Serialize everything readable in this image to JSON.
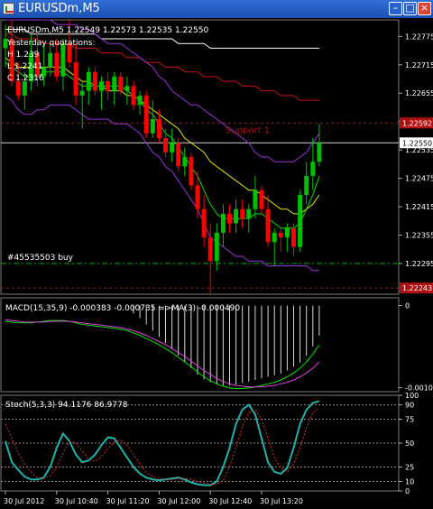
{
  "window": {
    "title": "EURUSDm,M5",
    "icon": "chart-window-icon",
    "buttons": {
      "minimize": "–",
      "maximize": "□",
      "close": "×"
    }
  },
  "colors": {
    "background": "#000000",
    "grid": "#6a6a6a",
    "axis_text": "#ffffff",
    "bull": "#00c000",
    "bear": "#ff0000",
    "bollinger": "#9b30d9",
    "ma_yellow": "#e6e600",
    "ma_green": "#00e000",
    "ma_red": "#d01010",
    "ma_white": "#ffffff",
    "support": "#b01010",
    "buy_line": "#00b000",
    "stoch_main": "#20b2aa",
    "stoch_signal": "#e03030"
  },
  "chart_data": [
    {
      "type": "candlestick",
      "title": "EURUSDm,M5  1.22549 1.22573 1.22535 1.22550",
      "notes": [
        "Yesterday quotations:",
        "H 1.239",
        "L 1.2241",
        "C 1.2316"
      ],
      "support_label": "Support 1",
      "support_price": 1.22592,
      "bid_price": 1.2255,
      "buy_level": 1.22295,
      "buy_label": "#45535503 buy",
      "bottom_level": 1.22243,
      "ylim": [
        1.2223,
        1.2281
      ],
      "y_ticks": [
        "1.22775",
        "1.22715",
        "1.22655",
        "1.22595",
        "1.22535",
        "1.22475",
        "1.22415",
        "1.22355",
        "1.22295"
      ],
      "highlight_ticks": [
        {
          "label": "1.22592",
          "value": 1.22592,
          "color": "#b01010"
        },
        {
          "label": "1.22550",
          "value": 1.2255,
          "color": "#ffffff"
        },
        {
          "label": "1.22243",
          "value": 1.22243,
          "color": "#b01010"
        }
      ],
      "candles": [
        [
          1.2275,
          1.228,
          1.2271,
          1.2277
        ],
        [
          1.2277,
          1.2281,
          1.2267,
          1.2268
        ],
        [
          1.2268,
          1.2272,
          1.2264,
          1.2265
        ],
        [
          1.2265,
          1.227,
          1.2262,
          1.2268
        ],
        [
          1.2268,
          1.2278,
          1.2266,
          1.2274
        ],
        [
          1.2274,
          1.2278,
          1.2267,
          1.2269
        ],
        [
          1.2269,
          1.2276,
          1.2267,
          1.2271
        ],
        [
          1.2271,
          1.2276,
          1.2269,
          1.2274
        ],
        [
          1.2274,
          1.2277,
          1.2268,
          1.2269
        ],
        [
          1.2269,
          1.2277,
          1.2266,
          1.2276
        ],
        [
          1.2276,
          1.2281,
          1.2271,
          1.2272
        ],
        [
          1.2272,
          1.2276,
          1.2263,
          1.2265
        ],
        [
          1.2265,
          1.2268,
          1.2258,
          1.2266
        ],
        [
          1.2266,
          1.2271,
          1.2263,
          1.227
        ],
        [
          1.227,
          1.2271,
          1.2265,
          1.2266
        ],
        [
          1.2266,
          1.2269,
          1.2262,
          1.2268
        ],
        [
          1.2268,
          1.227,
          1.2264,
          1.2266
        ],
        [
          1.2266,
          1.227,
          1.2263,
          1.2269
        ],
        [
          1.2269,
          1.227,
          1.2265,
          1.2266
        ],
        [
          1.2266,
          1.2269,
          1.2263,
          1.2267
        ],
        [
          1.2267,
          1.2268,
          1.2262,
          1.2263
        ],
        [
          1.2263,
          1.2266,
          1.2261,
          1.2265
        ],
        [
          1.2265,
          1.2266,
          1.2256,
          1.2257
        ],
        [
          1.2257,
          1.2264,
          1.2256,
          1.226
        ],
        [
          1.226,
          1.2262,
          1.2255,
          1.2256
        ],
        [
          1.2256,
          1.2258,
          1.2252,
          1.2253
        ],
        [
          1.2253,
          1.2258,
          1.2251,
          1.2255
        ],
        [
          1.2255,
          1.2256,
          1.2249,
          1.225
        ],
        [
          1.225,
          1.2254,
          1.2248,
          1.2252
        ],
        [
          1.2252,
          1.2253,
          1.2245,
          1.2246
        ],
        [
          1.2246,
          1.2249,
          1.2239,
          1.2241
        ],
        [
          1.2241,
          1.2244,
          1.2233,
          1.2235
        ],
        [
          1.2235,
          1.2238,
          1.2223,
          1.223
        ],
        [
          1.223,
          1.2238,
          1.2228,
          1.2236
        ],
        [
          1.2236,
          1.2242,
          1.2233,
          1.224
        ],
        [
          1.224,
          1.2242,
          1.2236,
          1.2238
        ],
        [
          1.2238,
          1.2243,
          1.2236,
          1.2241
        ],
        [
          1.2241,
          1.2243,
          1.2237,
          1.2239
        ],
        [
          1.2239,
          1.2242,
          1.2236,
          1.2241
        ],
        [
          1.2241,
          1.2248,
          1.2239,
          1.2245
        ],
        [
          1.2245,
          1.2246,
          1.224,
          1.2241
        ],
        [
          1.2241,
          1.2244,
          1.2233,
          1.2234
        ],
        [
          1.2234,
          1.2237,
          1.2229,
          1.2236
        ],
        [
          1.2236,
          1.2237,
          1.2232,
          1.2235
        ],
        [
          1.2235,
          1.2238,
          1.2232,
          1.2237
        ],
        [
          1.2237,
          1.2238,
          1.2231,
          1.2233
        ],
        [
          1.2233,
          1.2245,
          1.2232,
          1.2244
        ],
        [
          1.2244,
          1.2251,
          1.2242,
          1.2248
        ],
        [
          1.2248,
          1.2256,
          1.2245,
          1.2251
        ],
        [
          1.2251,
          1.2259,
          1.225,
          1.2255
        ]
      ],
      "lines": [
        {
          "name": "MA white",
          "color": "#ffffff",
          "values": [
            1.2279,
            1.2279,
            1.2279,
            1.2279,
            1.2278,
            1.2278,
            1.2278,
            1.2278,
            1.2278,
            1.2278,
            1.2278,
            1.2278,
            1.2278,
            1.2278,
            1.2278,
            1.2277,
            1.2277,
            1.2277,
            1.2277,
            1.2277,
            1.2277,
            1.2277,
            1.2277,
            1.2277,
            1.2277,
            1.2277,
            1.2277,
            1.2276,
            1.2276,
            1.2276,
            1.2276,
            1.2276,
            1.2275,
            1.2275,
            1.2275,
            1.2275,
            1.2275,
            1.2275,
            1.2275,
            1.2275,
            1.2275,
            1.2275,
            1.2275,
            1.2275,
            1.2275,
            1.2275,
            1.2275,
            1.2275,
            1.2275,
            1.2275
          ]
        },
        {
          "name": "MA red",
          "color": "#d01010",
          "values": [
            1.2278,
            1.2278,
            1.2277,
            1.2277,
            1.2277,
            1.2277,
            1.2276,
            1.2276,
            1.2276,
            1.2276,
            1.2276,
            1.2275,
            1.2275,
            1.2275,
            1.2275,
            1.2274,
            1.2274,
            1.2274,
            1.2274,
            1.2273,
            1.2273,
            1.2273,
            1.2272,
            1.2272,
            1.2272,
            1.2271,
            1.2271,
            1.2271,
            1.227,
            1.227,
            1.227,
            1.2269,
            1.2269,
            1.2269,
            1.2268,
            1.2268,
            1.2268,
            1.2267,
            1.2267,
            1.2267,
            1.2266,
            1.2266,
            1.2266,
            1.2265,
            1.2265,
            1.2265,
            1.2264,
            1.2264,
            1.2264,
            1.2264
          ]
        },
        {
          "name": "BB upper",
          "color": "#9b30d9",
          "values": [
            1.2281,
            1.2281,
            1.2281,
            1.2281,
            1.2281,
            1.2281,
            1.2281,
            1.2281,
            1.228,
            1.228,
            1.228,
            1.228,
            1.2279,
            1.2279,
            1.2278,
            1.2277,
            1.2276,
            1.2276,
            1.2276,
            1.2275,
            1.2274,
            1.2273,
            1.2272,
            1.2271,
            1.2269,
            1.2268,
            1.2266,
            1.2265,
            1.2264,
            1.2263,
            1.2263,
            1.2262,
            1.2261,
            1.226,
            1.2259,
            1.2258,
            1.2257,
            1.2256,
            1.2255,
            1.2253,
            1.2252,
            1.2252,
            1.2251,
            1.2251,
            1.2251,
            1.2251,
            1.2252,
            1.2253,
            1.2255,
            1.2257
          ]
        },
        {
          "name": "BB middle",
          "color": "#e6e600",
          "values": [
            1.2273,
            1.2272,
            1.2271,
            1.2271,
            1.2271,
            1.2271,
            1.2271,
            1.2271,
            1.2271,
            1.2271,
            1.227,
            1.2269,
            1.2268,
            1.2268,
            1.2267,
            1.2267,
            1.2266,
            1.2266,
            1.2266,
            1.2265,
            1.2265,
            1.2264,
            1.2263,
            1.2262,
            1.2261,
            1.226,
            1.2259,
            1.2258,
            1.2256,
            1.2255,
            1.2254,
            1.2253,
            1.2251,
            1.225,
            1.2249,
            1.2248,
            1.2247,
            1.2246,
            1.2245,
            1.2245,
            1.2244,
            1.2243,
            1.2242,
            1.2241,
            1.2241,
            1.224,
            1.224,
            1.2241,
            1.2242,
            1.2244
          ]
        },
        {
          "name": "BB lower",
          "color": "#9b30d9",
          "values": [
            1.2265,
            1.2264,
            1.2262,
            1.2261,
            1.2261,
            1.2262,
            1.2262,
            1.2263,
            1.2263,
            1.2263,
            1.2263,
            1.2262,
            1.2261,
            1.226,
            1.226,
            1.226,
            1.226,
            1.2259,
            1.2259,
            1.2259,
            1.2258,
            1.2257,
            1.2255,
            1.2253,
            1.2252,
            1.225,
            1.2249,
            1.2247,
            1.2245,
            1.2243,
            1.2241,
            1.2238,
            1.2235,
            1.2234,
            1.2233,
            1.2232,
            1.2231,
            1.2231,
            1.223,
            1.223,
            1.223,
            1.2229,
            1.2229,
            1.2229,
            1.2229,
            1.2229,
            1.2229,
            1.2229,
            1.2228,
            1.2228
          ]
        },
        {
          "name": "MA green",
          "color": "#00e000",
          "values": [
            1.2272,
            1.2271,
            1.227,
            1.2269,
            1.2269,
            1.2269,
            1.227,
            1.227,
            1.227,
            1.227,
            1.2269,
            1.2268,
            1.2267,
            1.2267,
            1.2267,
            1.2267,
            1.2267,
            1.2267,
            1.2267,
            1.2266,
            1.2265,
            1.2264,
            1.2262,
            1.2261,
            1.2259,
            1.2257,
            1.2256,
            1.2254,
            1.2252,
            1.225,
            1.2248,
            1.2245,
            1.2242,
            1.224,
            1.2239,
            1.2239,
            1.2239,
            1.2239,
            1.2239,
            1.224,
            1.224,
            1.2239,
            1.2238,
            1.2237,
            1.2237,
            1.2237,
            1.2238,
            1.2241,
            1.2244,
            1.2248
          ]
        }
      ],
      "x_ticks": [
        "30 Jul 2012",
        "30 Jul 10:40",
        "30 Jul 11:20",
        "30 Jul 12:00",
        "30 Jul 12:40",
        "30 Jul 13:20"
      ]
    },
    {
      "type": "bar",
      "title": "MACD(15,35,9) -0.000383 -0.000735 =>MA(3) -0.000490",
      "ylim": [
        -0.0011,
        0.0001
      ],
      "y_ticks": [
        {
          "label": "0",
          "value": 0.0
        },
        {
          "label": "-0.00105",
          "value": -0.00105
        }
      ],
      "histogram": [
        0.0,
        0.0,
        0.0,
        0.0,
        0.0,
        0.0,
        0.0,
        0.0,
        0.0,
        0.0,
        0.0,
        0.0,
        0.0,
        0.0,
        0.0,
        0.0,
        0.0,
        0.0,
        0.0,
        0.0,
        -0.0001,
        -0.00016,
        -0.00024,
        -0.00032,
        -0.0004,
        -0.00048,
        -0.00056,
        -0.00064,
        -0.00072,
        -0.0008,
        -0.00088,
        -0.00094,
        -0.00098,
        -0.00101,
        -0.00102,
        -0.00102,
        -0.00101,
        -0.00099,
        -0.00097,
        -0.00095,
        -0.00093,
        -0.00091,
        -0.00089,
        -0.00087,
        -0.00083,
        -0.00078,
        -0.00073,
        -0.00064,
        -0.00052,
        -0.00038
      ],
      "series": [
        {
          "name": "MACD",
          "color": "#00e000",
          "values": [
            -0.0002,
            -0.00021,
            -0.00022,
            -0.00022,
            -0.00022,
            -0.00021,
            -0.0002,
            -0.00019,
            -0.00019,
            -0.00019,
            -0.0002,
            -0.00022,
            -0.00024,
            -0.00025,
            -0.00026,
            -0.00027,
            -0.00028,
            -0.00029,
            -0.0003,
            -0.00032,
            -0.00035,
            -0.00038,
            -0.00042,
            -0.00046,
            -0.0005,
            -0.00055,
            -0.0006,
            -0.00066,
            -0.00072,
            -0.00078,
            -0.00085,
            -0.00091,
            -0.00096,
            -0.001,
            -0.00103,
            -0.00105,
            -0.00106,
            -0.00106,
            -0.00105,
            -0.00104,
            -0.00102,
            -0.001,
            -0.00098,
            -0.00095,
            -0.00091,
            -0.00086,
            -0.0008,
            -0.00072,
            -0.00062,
            -0.0005
          ]
        },
        {
          "name": "Signal",
          "color": "#e040e0",
          "values": [
            -0.00018,
            -0.00019,
            -0.0002,
            -0.00021,
            -0.00021,
            -0.00021,
            -0.00021,
            -0.0002,
            -0.0002,
            -0.0002,
            -0.0002,
            -0.00021,
            -0.00022,
            -0.00023,
            -0.00024,
            -0.00025,
            -0.00026,
            -0.00027,
            -0.00028,
            -0.0003,
            -0.00032,
            -0.00035,
            -0.00038,
            -0.00042,
            -0.00046,
            -0.0005,
            -0.00055,
            -0.0006,
            -0.00065,
            -0.00071,
            -0.00077,
            -0.00083,
            -0.00088,
            -0.00093,
            -0.00097,
            -0.001,
            -0.00102,
            -0.00103,
            -0.00104,
            -0.00104,
            -0.00104,
            -0.00103,
            -0.00102,
            -0.001,
            -0.00098,
            -0.00095,
            -0.00091,
            -0.00086,
            -0.0008,
            -0.00072
          ]
        }
      ]
    },
    {
      "type": "line",
      "title": "Stoch(5,3,3) 94.1176 86.9778",
      "ylim": [
        0,
        100
      ],
      "y_ticks": [
        {
          "label": "100",
          "value": 100
        },
        {
          "label": "90",
          "value": 90
        },
        {
          "label": "75",
          "value": 75
        },
        {
          "label": "50",
          "value": 50
        },
        {
          "label": "25",
          "value": 25
        },
        {
          "label": "10",
          "value": 10
        },
        {
          "label": "0",
          "value": 0
        }
      ],
      "levels": [
        90,
        75,
        50,
        25,
        10
      ],
      "series": [
        {
          "name": "Main",
          "color": "#20b2aa",
          "values": [
            52,
            30,
            22,
            15,
            12,
            12,
            14,
            25,
            45,
            60,
            52,
            38,
            30,
            32,
            38,
            48,
            56,
            55,
            45,
            35,
            25,
            18,
            14,
            12,
            11,
            12,
            13,
            14,
            12,
            9,
            7,
            6,
            6,
            10,
            25,
            45,
            70,
            85,
            90,
            80,
            55,
            30,
            20,
            18,
            24,
            45,
            70,
            85,
            92,
            94
          ]
        },
        {
          "name": "Signal",
          "color": "#e03030",
          "values": [
            70,
            55,
            40,
            28,
            20,
            14,
            13,
            16,
            25,
            40,
            52,
            50,
            42,
            33,
            31,
            36,
            44,
            51,
            53,
            48,
            38,
            28,
            19,
            15,
            13,
            12,
            12,
            13,
            13,
            12,
            10,
            8,
            7,
            7,
            11,
            25,
            45,
            67,
            82,
            85,
            75,
            55,
            35,
            24,
            20,
            28,
            45,
            66,
            82,
            87
          ]
        }
      ]
    }
  ]
}
